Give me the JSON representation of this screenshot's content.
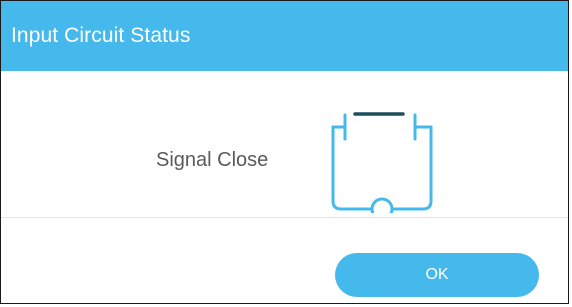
{
  "dialog": {
    "title": "Input Circuit Status",
    "status_label": "Signal Close",
    "icon": "circuit-closed-icon",
    "ok_label": "OK"
  },
  "colors": {
    "accent": "#45b8ec",
    "title_text": "#ffffff",
    "label_text": "#5a5a5a",
    "icon_stroke": "#45b8ec",
    "switch_bar": "#1f4e5c",
    "divider": "#e3e3e3"
  }
}
